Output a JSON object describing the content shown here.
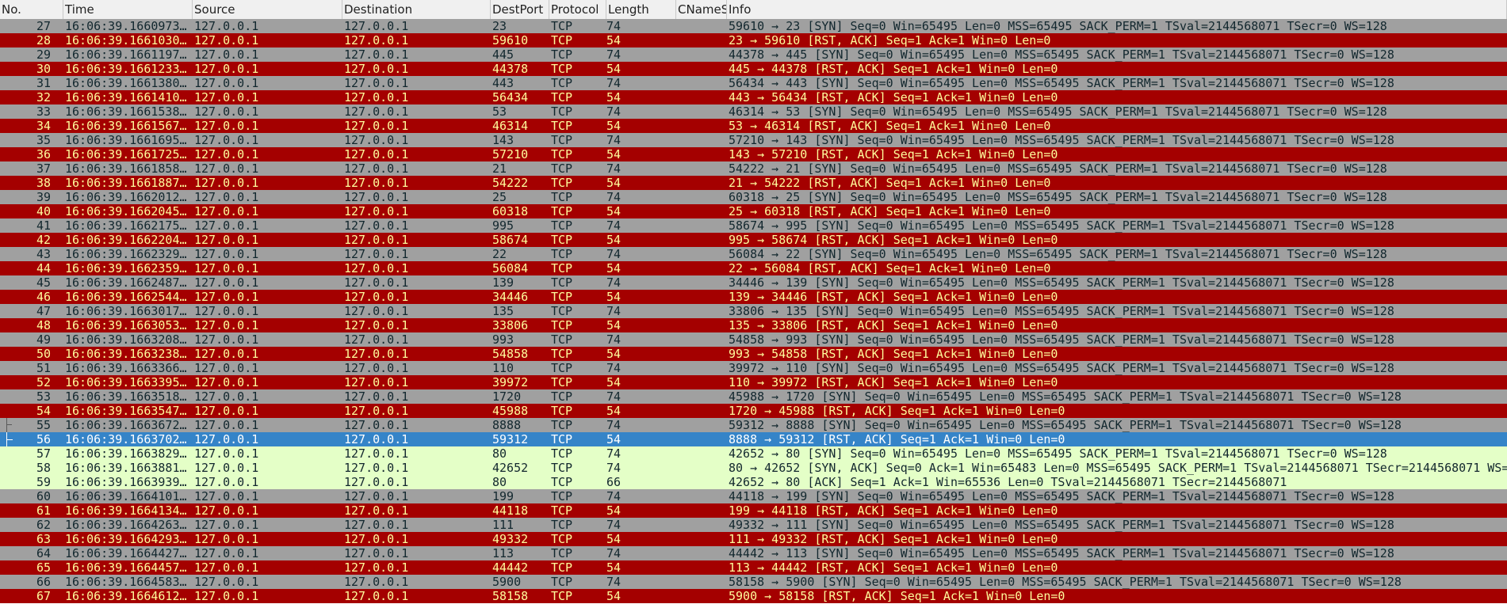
{
  "columns": [
    "No.",
    "Time",
    "Source",
    "Destination",
    "DestPort",
    "Protocol",
    "Length",
    "CNameS",
    "Info"
  ],
  "rows": [
    [
      "27",
      "16:06:39.1660973…",
      "127.0.0.1",
      "127.0.0.1",
      "23",
      "TCP",
      "74",
      "",
      "59610 → 23 [SYN] Seq=0 Win=65495 Len=0 MSS=65495 SACK_PERM=1 TSval=2144568071 TSecr=0 WS=128"
    ],
    [
      "28",
      "16:06:39.1661030…",
      "127.0.0.1",
      "127.0.0.1",
      "59610",
      "TCP",
      "54",
      "",
      "23 → 59610 [RST, ACK] Seq=1 Ack=1 Win=0 Len=0"
    ],
    [
      "29",
      "16:06:39.1661197…",
      "127.0.0.1",
      "127.0.0.1",
      "445",
      "TCP",
      "74",
      "",
      "44378 → 445 [SYN] Seq=0 Win=65495 Len=0 MSS=65495 SACK_PERM=1 TSval=2144568071 TSecr=0 WS=128"
    ],
    [
      "30",
      "16:06:39.1661233…",
      "127.0.0.1",
      "127.0.0.1",
      "44378",
      "TCP",
      "54",
      "",
      "445 → 44378 [RST, ACK] Seq=1 Ack=1 Win=0 Len=0"
    ],
    [
      "31",
      "16:06:39.1661380…",
      "127.0.0.1",
      "127.0.0.1",
      "443",
      "TCP",
      "74",
      "",
      "56434 → 443 [SYN] Seq=0 Win=65495 Len=0 MSS=65495 SACK_PERM=1 TSval=2144568071 TSecr=0 WS=128"
    ],
    [
      "32",
      "16:06:39.1661410…",
      "127.0.0.1",
      "127.0.0.1",
      "56434",
      "TCP",
      "54",
      "",
      "443 → 56434 [RST, ACK] Seq=1 Ack=1 Win=0 Len=0"
    ],
    [
      "33",
      "16:06:39.1661538…",
      "127.0.0.1",
      "127.0.0.1",
      "53",
      "TCP",
      "74",
      "",
      "46314 → 53 [SYN] Seq=0 Win=65495 Len=0 MSS=65495 SACK_PERM=1 TSval=2144568071 TSecr=0 WS=128"
    ],
    [
      "34",
      "16:06:39.1661567…",
      "127.0.0.1",
      "127.0.0.1",
      "46314",
      "TCP",
      "54",
      "",
      "53 → 46314 [RST, ACK] Seq=1 Ack=1 Win=0 Len=0"
    ],
    [
      "35",
      "16:06:39.1661695…",
      "127.0.0.1",
      "127.0.0.1",
      "143",
      "TCP",
      "74",
      "",
      "57210 → 143 [SYN] Seq=0 Win=65495 Len=0 MSS=65495 SACK_PERM=1 TSval=2144568071 TSecr=0 WS=128"
    ],
    [
      "36",
      "16:06:39.1661725…",
      "127.0.0.1",
      "127.0.0.1",
      "57210",
      "TCP",
      "54",
      "",
      "143 → 57210 [RST, ACK] Seq=1 Ack=1 Win=0 Len=0"
    ],
    [
      "37",
      "16:06:39.1661858…",
      "127.0.0.1",
      "127.0.0.1",
      "21",
      "TCP",
      "74",
      "",
      "54222 → 21 [SYN] Seq=0 Win=65495 Len=0 MSS=65495 SACK_PERM=1 TSval=2144568071 TSecr=0 WS=128"
    ],
    [
      "38",
      "16:06:39.1661887…",
      "127.0.0.1",
      "127.0.0.1",
      "54222",
      "TCP",
      "54",
      "",
      "21 → 54222 [RST, ACK] Seq=1 Ack=1 Win=0 Len=0"
    ],
    [
      "39",
      "16:06:39.1662012…",
      "127.0.0.1",
      "127.0.0.1",
      "25",
      "TCP",
      "74",
      "",
      "60318 → 25 [SYN] Seq=0 Win=65495 Len=0 MSS=65495 SACK_PERM=1 TSval=2144568071 TSecr=0 WS=128"
    ],
    [
      "40",
      "16:06:39.1662045…",
      "127.0.0.1",
      "127.0.0.1",
      "60318",
      "TCP",
      "54",
      "",
      "25 → 60318 [RST, ACK] Seq=1 Ack=1 Win=0 Len=0"
    ],
    [
      "41",
      "16:06:39.1662175…",
      "127.0.0.1",
      "127.0.0.1",
      "995",
      "TCP",
      "74",
      "",
      "58674 → 995 [SYN] Seq=0 Win=65495 Len=0 MSS=65495 SACK_PERM=1 TSval=2144568071 TSecr=0 WS=128"
    ],
    [
      "42",
      "16:06:39.1662204…",
      "127.0.0.1",
      "127.0.0.1",
      "58674",
      "TCP",
      "54",
      "",
      "995 → 58674 [RST, ACK] Seq=1 Ack=1 Win=0 Len=0"
    ],
    [
      "43",
      "16:06:39.1662329…",
      "127.0.0.1",
      "127.0.0.1",
      "22",
      "TCP",
      "74",
      "",
      "56084 → 22 [SYN] Seq=0 Win=65495 Len=0 MSS=65495 SACK_PERM=1 TSval=2144568071 TSecr=0 WS=128"
    ],
    [
      "44",
      "16:06:39.1662359…",
      "127.0.0.1",
      "127.0.0.1",
      "56084",
      "TCP",
      "54",
      "",
      "22 → 56084 [RST, ACK] Seq=1 Ack=1 Win=0 Len=0"
    ],
    [
      "45",
      "16:06:39.1662487…",
      "127.0.0.1",
      "127.0.0.1",
      "139",
      "TCP",
      "74",
      "",
      "34446 → 139 [SYN] Seq=0 Win=65495 Len=0 MSS=65495 SACK_PERM=1 TSval=2144568071 TSecr=0 WS=128"
    ],
    [
      "46",
      "16:06:39.1662544…",
      "127.0.0.1",
      "127.0.0.1",
      "34446",
      "TCP",
      "54",
      "",
      "139 → 34446 [RST, ACK] Seq=1 Ack=1 Win=0 Len=0"
    ],
    [
      "47",
      "16:06:39.1663017…",
      "127.0.0.1",
      "127.0.0.1",
      "135",
      "TCP",
      "74",
      "",
      "33806 → 135 [SYN] Seq=0 Win=65495 Len=0 MSS=65495 SACK_PERM=1 TSval=2144568071 TSecr=0 WS=128"
    ],
    [
      "48",
      "16:06:39.1663053…",
      "127.0.0.1",
      "127.0.0.1",
      "33806",
      "TCP",
      "54",
      "",
      "135 → 33806 [RST, ACK] Seq=1 Ack=1 Win=0 Len=0"
    ],
    [
      "49",
      "16:06:39.1663208…",
      "127.0.0.1",
      "127.0.0.1",
      "993",
      "TCP",
      "74",
      "",
      "54858 → 993 [SYN] Seq=0 Win=65495 Len=0 MSS=65495 SACK_PERM=1 TSval=2144568071 TSecr=0 WS=128"
    ],
    [
      "50",
      "16:06:39.1663238…",
      "127.0.0.1",
      "127.0.0.1",
      "54858",
      "TCP",
      "54",
      "",
      "993 → 54858 [RST, ACK] Seq=1 Ack=1 Win=0 Len=0"
    ],
    [
      "51",
      "16:06:39.1663366…",
      "127.0.0.1",
      "127.0.0.1",
      "110",
      "TCP",
      "74",
      "",
      "39972 → 110 [SYN] Seq=0 Win=65495 Len=0 MSS=65495 SACK_PERM=1 TSval=2144568071 TSecr=0 WS=128"
    ],
    [
      "52",
      "16:06:39.1663395…",
      "127.0.0.1",
      "127.0.0.1",
      "39972",
      "TCP",
      "54",
      "",
      "110 → 39972 [RST, ACK] Seq=1 Ack=1 Win=0 Len=0"
    ],
    [
      "53",
      "16:06:39.1663518…",
      "127.0.0.1",
      "127.0.0.1",
      "1720",
      "TCP",
      "74",
      "",
      "45988 → 1720 [SYN] Seq=0 Win=65495 Len=0 MSS=65495 SACK_PERM=1 TSval=2144568071 TSecr=0 WS=128"
    ],
    [
      "54",
      "16:06:39.1663547…",
      "127.0.0.1",
      "127.0.0.1",
      "45988",
      "TCP",
      "54",
      "",
      "1720 → 45988 [RST, ACK] Seq=1 Ack=1 Win=0 Len=0"
    ],
    [
      "55",
      "16:06:39.1663672…",
      "127.0.0.1",
      "127.0.0.1",
      "8888",
      "TCP",
      "74",
      "",
      "59312 → 8888 [SYN] Seq=0 Win=65495 Len=0 MSS=65495 SACK_PERM=1 TSval=2144568071 TSecr=0 WS=128"
    ],
    [
      "56",
      "16:06:39.1663702…",
      "127.0.0.1",
      "127.0.0.1",
      "59312",
      "TCP",
      "54",
      "",
      "8888 → 59312 [RST, ACK] Seq=1 Ack=1 Win=0 Len=0"
    ],
    [
      "57",
      "16:06:39.1663829…",
      "127.0.0.1",
      "127.0.0.1",
      "80",
      "TCP",
      "74",
      "",
      "42652 → 80 [SYN] Seq=0 Win=65495 Len=0 MSS=65495 SACK_PERM=1 TSval=2144568071 TSecr=0 WS=128"
    ],
    [
      "58",
      "16:06:39.1663881…",
      "127.0.0.1",
      "127.0.0.1",
      "42652",
      "TCP",
      "74",
      "",
      "80 → 42652 [SYN, ACK] Seq=0 Ack=1 Win=65483 Len=0 MSS=65495 SACK_PERM=1 TSval=2144568071 TSecr=2144568071 WS="
    ],
    [
      "59",
      "16:06:39.1663939…",
      "127.0.0.1",
      "127.0.0.1",
      "80",
      "TCP",
      "66",
      "",
      "42652 → 80 [ACK] Seq=1 Ack=1 Win=65536 Len=0 TSval=2144568071 TSecr=2144568071"
    ],
    [
      "60",
      "16:06:39.1664101…",
      "127.0.0.1",
      "127.0.0.1",
      "199",
      "TCP",
      "74",
      "",
      "44118 → 199 [SYN] Seq=0 Win=65495 Len=0 MSS=65495 SACK_PERM=1 TSval=2144568071 TSecr=0 WS=128"
    ],
    [
      "61",
      "16:06:39.1664134…",
      "127.0.0.1",
      "127.0.0.1",
      "44118",
      "TCP",
      "54",
      "",
      "199 → 44118 [RST, ACK] Seq=1 Ack=1 Win=0 Len=0"
    ],
    [
      "62",
      "16:06:39.1664263…",
      "127.0.0.1",
      "127.0.0.1",
      "111",
      "TCP",
      "74",
      "",
      "49332 → 111 [SYN] Seq=0 Win=65495 Len=0 MSS=65495 SACK_PERM=1 TSval=2144568071 TSecr=0 WS=128"
    ],
    [
      "63",
      "16:06:39.1664293…",
      "127.0.0.1",
      "127.0.0.1",
      "49332",
      "TCP",
      "54",
      "",
      "111 → 49332 [RST, ACK] Seq=1 Ack=1 Win=0 Len=0"
    ],
    [
      "64",
      "16:06:39.1664427…",
      "127.0.0.1",
      "127.0.0.1",
      "113",
      "TCP",
      "74",
      "",
      "44442 → 113 [SYN] Seq=0 Win=65495 Len=0 MSS=65495 SACK_PERM=1 TSval=2144568071 TSecr=0 WS=128"
    ],
    [
      "65",
      "16:06:39.1664457…",
      "127.0.0.1",
      "127.0.0.1",
      "44442",
      "TCP",
      "54",
      "",
      "113 → 44442 [RST, ACK] Seq=1 Ack=1 Win=0 Len=0"
    ],
    [
      "66",
      "16:06:39.1664583…",
      "127.0.0.1",
      "127.0.0.1",
      "5900",
      "TCP",
      "74",
      "",
      "58158 → 5900 [SYN] Seq=0 Win=65495 Len=0 MSS=65495 SACK_PERM=1 TSval=2144568071 TSecr=0 WS=128"
    ],
    [
      "67",
      "16:06:39.1664612…",
      "127.0.0.1",
      "127.0.0.1",
      "58158",
      "TCP",
      "54",
      "",
      "5900 → 58158 [RST, ACK] Seq=1 Ack=1 Win=0 Len=0"
    ]
  ],
  "row_kinds": [
    "syn",
    "rst",
    "syn",
    "rst",
    "syn",
    "rst",
    "syn",
    "rst",
    "syn",
    "rst",
    "syn",
    "rst",
    "syn",
    "rst",
    "syn",
    "rst",
    "syn",
    "rst",
    "syn",
    "rst",
    "syn",
    "rst",
    "syn",
    "rst",
    "syn",
    "rst",
    "syn",
    "rst",
    "syn",
    "sel",
    "http",
    "http",
    "http",
    "syn",
    "rst",
    "syn",
    "rst",
    "syn",
    "rst",
    "syn",
    "rst"
  ],
  "selected_row": 29,
  "colors": {
    "syn_bg": "#a0a0a0",
    "syn_fg": "#12272e",
    "rst_bg": "#a40000",
    "rst_fg": "#fffc9c",
    "http_bg": "#e4ffc7",
    "selected_bg": "#3584c8"
  }
}
